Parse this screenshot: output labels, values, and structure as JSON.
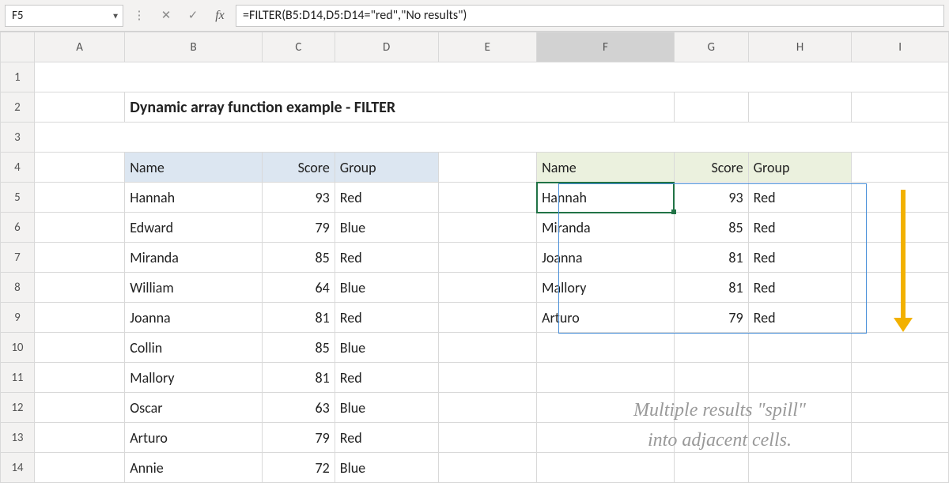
{
  "namebox": "F5",
  "formula": "=FILTER(B5:D14,D5:D14=\"red\",\"No results\")",
  "columns": [
    "A",
    "B",
    "C",
    "D",
    "E",
    "F",
    "G",
    "H",
    "I"
  ],
  "title": "Dynamic array function example - FILTER",
  "table1": {
    "headers": [
      "Name",
      "Score",
      "Group"
    ],
    "rows": [
      {
        "name": "Hannah",
        "score": 93,
        "group": "Red"
      },
      {
        "name": "Edward",
        "score": 79,
        "group": "Blue"
      },
      {
        "name": "Miranda",
        "score": 85,
        "group": "Red"
      },
      {
        "name": "William",
        "score": 64,
        "group": "Blue"
      },
      {
        "name": "Joanna",
        "score": 81,
        "group": "Red"
      },
      {
        "name": "Collin",
        "score": 85,
        "group": "Blue"
      },
      {
        "name": "Mallory",
        "score": 81,
        "group": "Red"
      },
      {
        "name": "Oscar",
        "score": 63,
        "group": "Blue"
      },
      {
        "name": "Arturo",
        "score": 79,
        "group": "Red"
      },
      {
        "name": "Annie",
        "score": 72,
        "group": "Blue"
      }
    ]
  },
  "table2": {
    "headers": [
      "Name",
      "Score",
      "Group"
    ],
    "rows": [
      {
        "name": "Hannah",
        "score": 93,
        "group": "Red"
      },
      {
        "name": "Miranda",
        "score": 85,
        "group": "Red"
      },
      {
        "name": "Joanna",
        "score": 81,
        "group": "Red"
      },
      {
        "name": "Mallory",
        "score": 81,
        "group": "Red"
      },
      {
        "name": "Arturo",
        "score": 79,
        "group": "Red"
      }
    ]
  },
  "annotation_line1": "Multiple results \"spill\"",
  "annotation_line2": "into adjacent cells.",
  "rows": [
    "1",
    "2",
    "3",
    "4",
    "5",
    "6",
    "7",
    "8",
    "9",
    "10",
    "11",
    "12",
    "13",
    "14"
  ]
}
